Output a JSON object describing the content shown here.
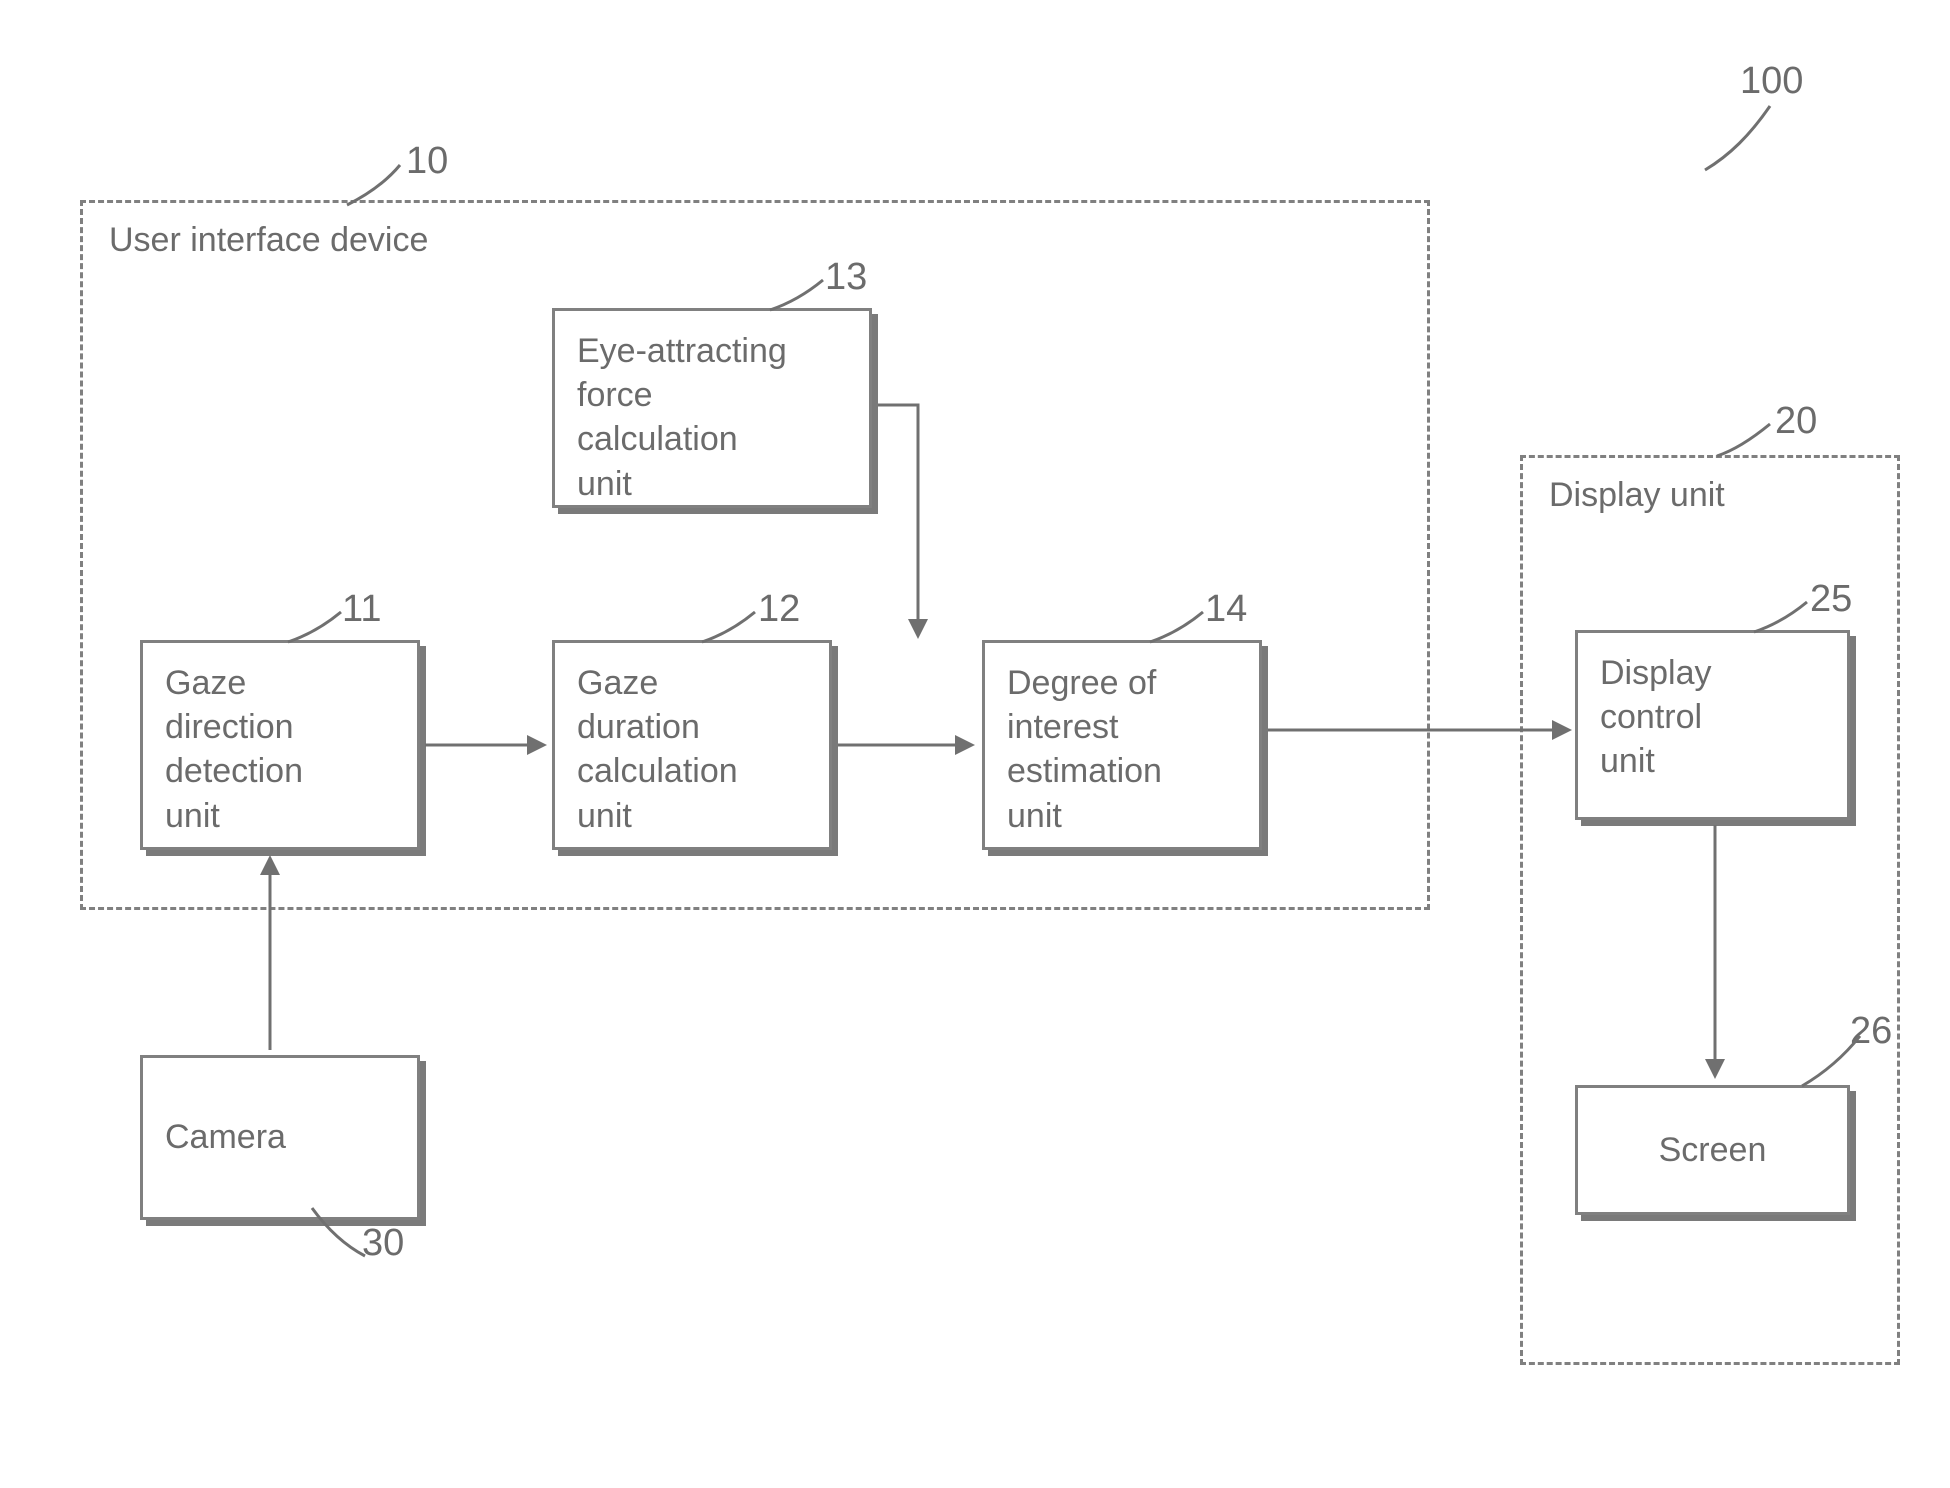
{
  "system": {
    "ref": "100"
  },
  "ui_device": {
    "ref": "10",
    "title": "User interface device",
    "blocks": {
      "gaze_direction": {
        "ref": "11",
        "label": "Gaze\ndirection\ndetection\nunit"
      },
      "gaze_duration": {
        "ref": "12",
        "label": "Gaze\nduration\ncalculation\nunit"
      },
      "eye_attracting": {
        "ref": "13",
        "label": "Eye-attracting\nforce\ncalculation\nunit"
      },
      "degree_interest": {
        "ref": "14",
        "label": "Degree of\ninterest\nestimation\nunit"
      }
    }
  },
  "display_unit": {
    "ref": "20",
    "title": "Display unit",
    "blocks": {
      "display_control": {
        "ref": "25",
        "label": "Display\ncontrol\nunit"
      },
      "screen": {
        "ref": "26",
        "label": "Screen"
      }
    }
  },
  "camera": {
    "ref": "30",
    "label": "Camera"
  },
  "chart_data": {
    "type": "diagram",
    "title": "System 100 block diagram",
    "containers": [
      {
        "id": "10",
        "label": "User interface device",
        "contains": [
          "11",
          "12",
          "13",
          "14"
        ]
      },
      {
        "id": "20",
        "label": "Display unit",
        "contains": [
          "25",
          "26"
        ]
      }
    ],
    "nodes": [
      {
        "id": "11",
        "label": "Gaze direction detection unit"
      },
      {
        "id": "12",
        "label": "Gaze duration calculation unit"
      },
      {
        "id": "13",
        "label": "Eye-attracting force calculation unit"
      },
      {
        "id": "14",
        "label": "Degree of interest estimation unit"
      },
      {
        "id": "25",
        "label": "Display control unit"
      },
      {
        "id": "26",
        "label": "Screen"
      },
      {
        "id": "30",
        "label": "Camera"
      }
    ],
    "edges": [
      {
        "from": "30",
        "to": "11"
      },
      {
        "from": "11",
        "to": "12"
      },
      {
        "from": "12",
        "to": "14"
      },
      {
        "from": "13",
        "to": "14"
      },
      {
        "from": "14",
        "to": "25"
      },
      {
        "from": "25",
        "to": "26"
      }
    ]
  }
}
